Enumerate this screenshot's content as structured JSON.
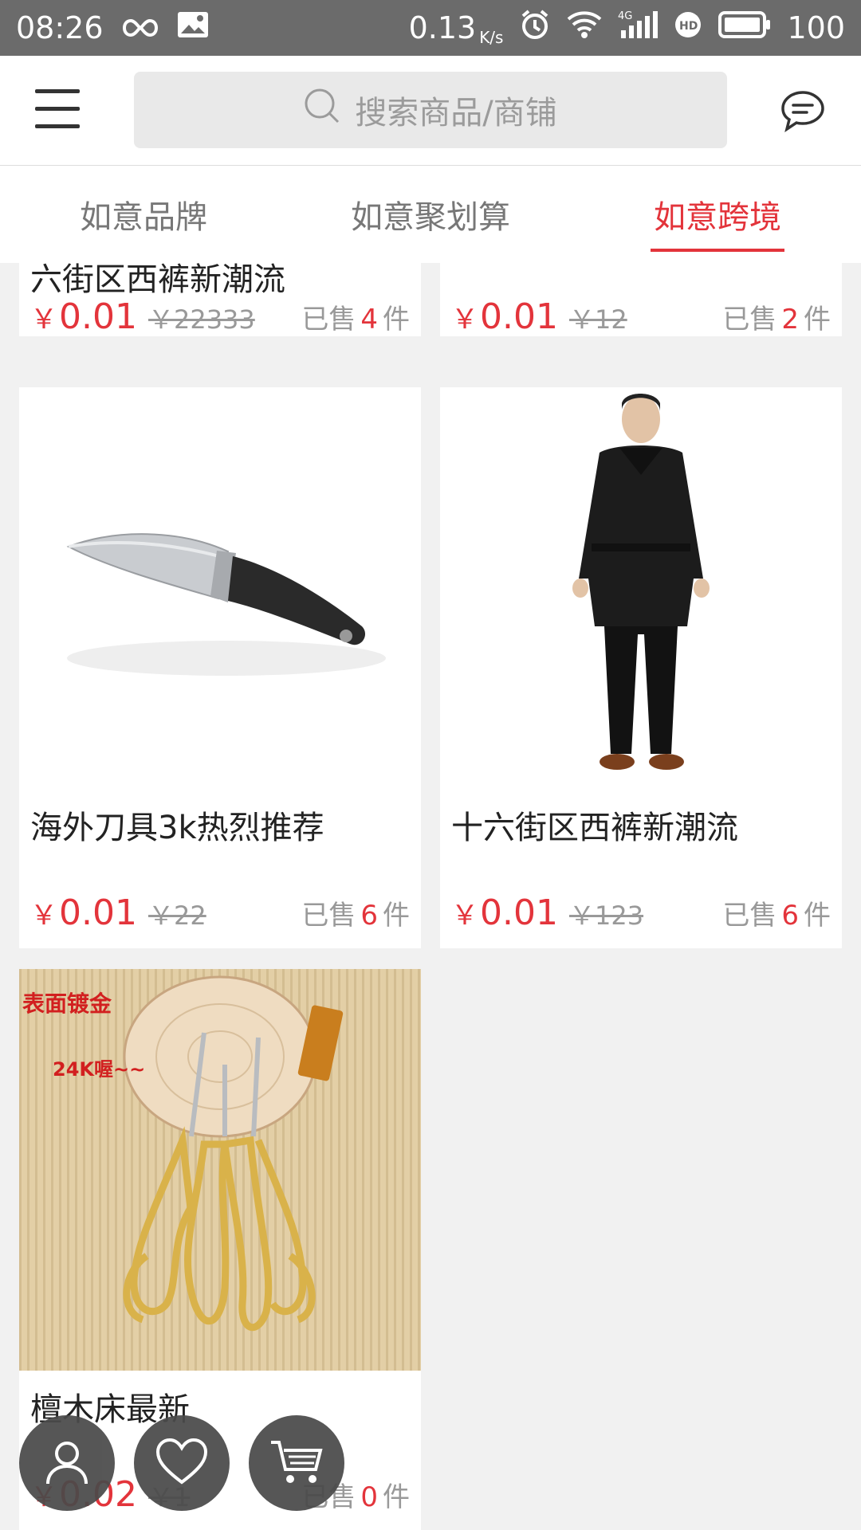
{
  "status_bar": {
    "time": "08:26",
    "speed": "0.13",
    "speed_unit": "K/s",
    "battery": "100",
    "icons": [
      "infinity-icon",
      "image-icon",
      "alarm-icon",
      "wifi-icon",
      "signal-4g-icon",
      "hd-icon",
      "battery-icon"
    ]
  },
  "header": {
    "search_placeholder": "搜索商品/商铺",
    "icons": [
      "menu-icon",
      "search-icon",
      "message-icon"
    ]
  },
  "tabs": [
    {
      "label": "如意品牌",
      "active": false
    },
    {
      "label": "如意聚划算",
      "active": false
    },
    {
      "label": "如意跨境",
      "active": true
    }
  ],
  "products": [
    {
      "title": "六街区西裤新潮流",
      "price": "0.01",
      "original": "￥22333",
      "sold_prefix": "已售",
      "sold": "4",
      "sold_suffix": "件"
    },
    {
      "title": "",
      "price": "0.01",
      "original": "￥12",
      "sold_prefix": "已售",
      "sold": "2",
      "sold_suffix": "件"
    },
    {
      "title": "海外刀具3k热烈推荐",
      "price": "0.01",
      "original": "￥22",
      "sold_prefix": "已售",
      "sold": "6",
      "sold_suffix": "件"
    },
    {
      "title": "十六街区西裤新潮流",
      "price": "0.01",
      "original": "￥123",
      "sold_prefix": "已售",
      "sold": "6",
      "sold_suffix": "件"
    },
    {
      "title": "檀木床最新",
      "price": "0.02",
      "original": "￥1",
      "sold_prefix": "已售",
      "sold": "0",
      "sold_suffix": "件",
      "image_text": [
        "表面镀金",
        "24K喔~~"
      ]
    }
  ],
  "currency_symbol": "￥",
  "floating_buttons": [
    "user-icon",
    "heart-icon",
    "cart-icon"
  ],
  "colors": {
    "accent": "#e3343b",
    "status_bar": "#6b6b6b"
  }
}
